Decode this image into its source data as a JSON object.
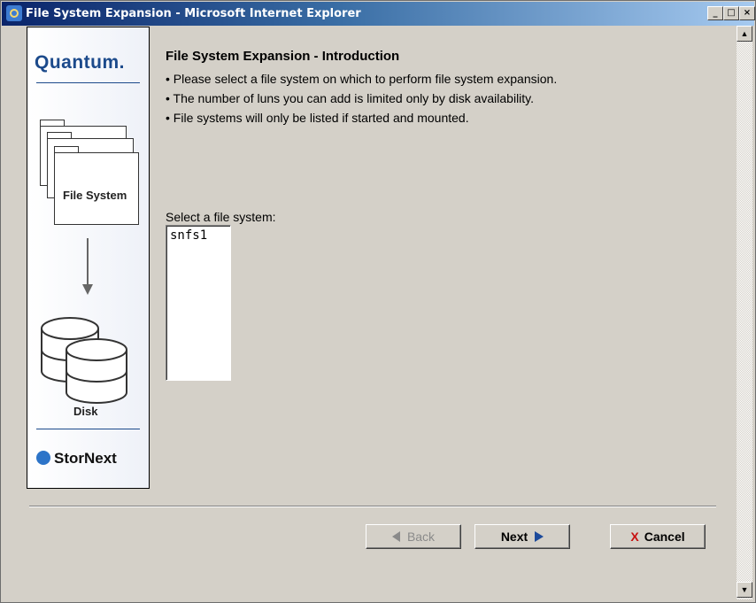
{
  "window": {
    "title": "File System Expansion - Microsoft Internet Explorer",
    "controls": {
      "minimize": "_",
      "maximize": "□",
      "close": "×"
    }
  },
  "sidebar": {
    "brand": "Quantum.",
    "file_system_label": "File System",
    "disk_label": "Disk",
    "product": "StorNext"
  },
  "main": {
    "title": "File System Expansion - Introduction",
    "bullets": [
      "• Please select a file system on which to perform file system expansion.",
      "• The number of luns you can add is limited only by disk availability.",
      "• File systems will only be listed if started and mounted."
    ],
    "select_label": "Select a file system:",
    "file_systems": [
      "snfs1"
    ]
  },
  "buttons": {
    "back": "Back",
    "next": "Next",
    "cancel": "Cancel"
  },
  "colors": {
    "titlebar_start": "#0a246a",
    "brand_blue": "#1c4a8b",
    "cancel_red": "#c81010"
  }
}
